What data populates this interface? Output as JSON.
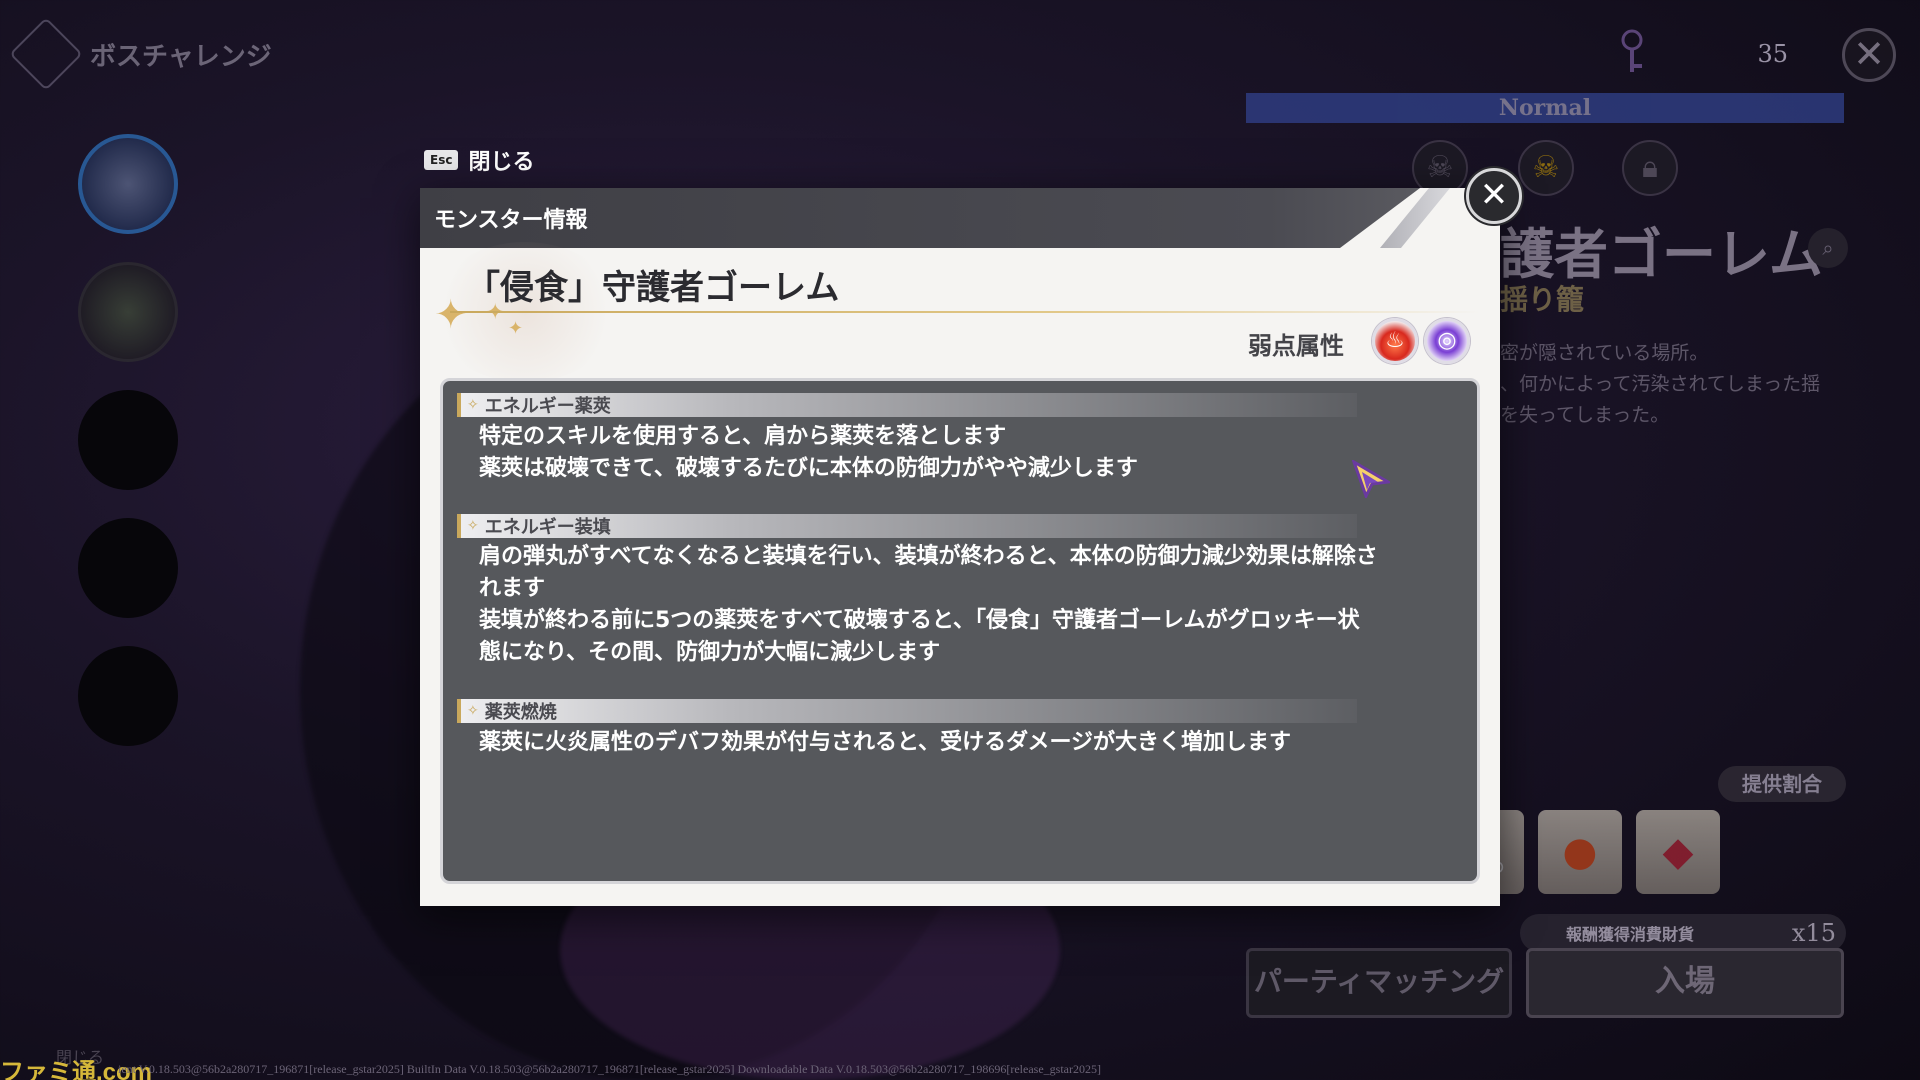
{
  "header": {
    "title": "ボスチャレンジ"
  },
  "top_right": {
    "count": "35"
  },
  "difficulty": {
    "label": "Normal"
  },
  "background_panel": {
    "title": "護者ゴーレム",
    "subtitle": "揺り籠",
    "desc_lines": [
      "密が隠されている場所。",
      "、何かによって汚染されてしまった揺",
      "を失ってしまった。"
    ],
    "rate_button": "提供割合",
    "currency_label": "報酬獲得消費財貨",
    "currency_count": "x15",
    "party_button": "パーティマッチング",
    "enter_button": "入場"
  },
  "esc_hint": {
    "key": "Esc",
    "label": "閉じる"
  },
  "modal": {
    "header_title": "モンスター情報",
    "monster_name": "「侵食」守護者ゴーレム",
    "weakness_label": "弱点属性",
    "weakness_icons": [
      "fire-icon",
      "arcane-icon"
    ],
    "sections": [
      {
        "title": "エネルギー薬莢",
        "lines": [
          "特定のスキルを使用すると、肩から薬莢を落とします",
          "薬莢は破壊できて、破壊するたびに本体の防御力がやや減少します"
        ]
      },
      {
        "title": "エネルギー装填",
        "lines": [
          "肩の弾丸がすべてなくなると装填を行い、装填が終わると、本体の防御力減少効果は解除さ",
          "れます",
          "装填が終わる前に5つの薬莢をすべて破壊すると、「侵食」守護者ゴーレムがグロッキー状",
          "態になり、その間、防御力が大幅に減少します"
        ]
      },
      {
        "title": "薬莢燃焼",
        "lines": [
          "薬莢に火炎属性のデバフ効果が付与されると、受けるダメージが大きく増加します"
        ]
      }
    ]
  },
  "footer": {
    "close_hint": "閉じる",
    "watermark": "ファミ通.com",
    "version": "ient V.0.18.503@56b2a280717_196871[release_gstar2025] BuiltIn Data V.0.18.503@56b2a280717_196871[release_gstar2025] Downloadable Data V.0.18.503@56b2a280717_198696[release_gstar2025]"
  },
  "colors": {
    "accent_gold": "#c9a85c",
    "panel_gray": "#56585c",
    "difficulty_blue": "#2f3f86"
  }
}
